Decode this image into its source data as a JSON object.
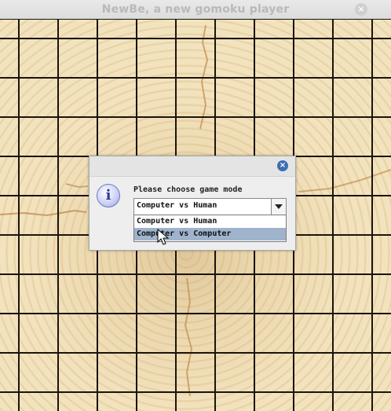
{
  "window": {
    "title": "NewBe, a new gomoku player",
    "close_glyph": "×"
  },
  "board": {
    "style": "wood-grain"
  },
  "dialog": {
    "icon_glyph": "i",
    "close_glyph": "×",
    "message": "Please choose game mode",
    "combo_value": "Computer vs Human",
    "options": [
      {
        "label": "Computer vs Human",
        "selected": false
      },
      {
        "label": "Computer vs Computer",
        "selected": true
      }
    ]
  }
}
